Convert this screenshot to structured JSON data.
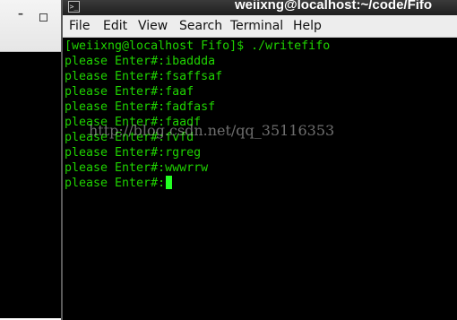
{
  "background_window": {
    "minimize_icon": "minimize-icon",
    "maximize_icon": "maximize-icon"
  },
  "terminal": {
    "title": "weiixng@localhost:~/code/Fifo",
    "menu": [
      "File",
      "Edit",
      "View",
      "Search",
      "Terminal",
      "Help"
    ],
    "prompt_line": "[weiixng@localhost Fifo]$ ./writefifo",
    "output_lines": [
      "please Enter#:ibaddda",
      "please Enter#:fsaffsaf",
      "please Enter#:faaf",
      "please Enter#:fadfasf",
      "please Enter#:faadf",
      "please Enter#:fvfd",
      "please Enter#:rgreg",
      "please Enter#:wwwrrw"
    ],
    "current_prompt": "please Enter#:",
    "text_color": "#1fd300",
    "background_color": "#000000"
  },
  "watermark": "http://blog.csdn.net/qq_35116353"
}
